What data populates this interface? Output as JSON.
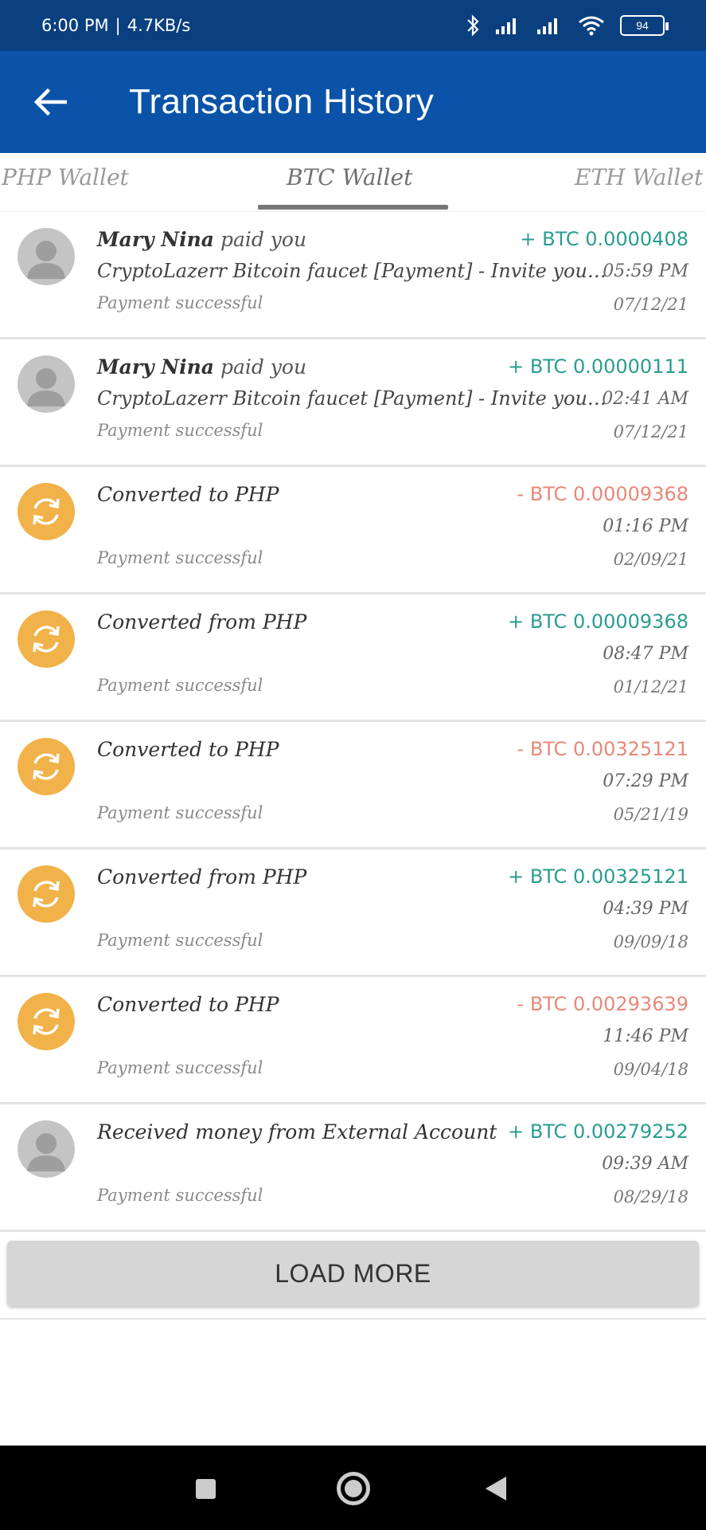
{
  "status_bar": {
    "time": "6:00 PM",
    "separator": "|",
    "net_speed": "4.7KB/s",
    "battery": "94"
  },
  "app_bar": {
    "title": "Transaction History",
    "back_icon": "arrow-left-icon"
  },
  "tabs": [
    {
      "label": "PHP Wallet",
      "active": false
    },
    {
      "label": "BTC Wallet",
      "active": true
    },
    {
      "label": "ETH Wallet",
      "active": false
    }
  ],
  "transactions": [
    {
      "avatar": "person",
      "name": "Mary Nina",
      "verb": "paid you",
      "title": "",
      "amount": "+ BTC 0.0000408",
      "sign": "pos",
      "description": "CryptoLazerr Bitcoin faucet [Payment] - Invite your friends",
      "time": "05:59 PM",
      "status": "Payment successful",
      "date": "07/12/21"
    },
    {
      "avatar": "person",
      "name": "Mary Nina",
      "verb": "paid you",
      "title": "",
      "amount": "+ BTC 0.00000111",
      "sign": "pos",
      "description": "CryptoLazerr Bitcoin faucet [Payment] - Invite your friends",
      "time": "02:41 AM",
      "status": "Payment successful",
      "date": "07/12/21"
    },
    {
      "avatar": "convert",
      "name": "",
      "verb": "",
      "title": "Converted to PHP",
      "amount": "- BTC 0.00009368",
      "sign": "neg",
      "description": "",
      "time": "01:16 PM",
      "status": "Payment successful",
      "date": "02/09/21"
    },
    {
      "avatar": "convert",
      "name": "",
      "verb": "",
      "title": "Converted from PHP",
      "amount": "+ BTC 0.00009368",
      "sign": "pos",
      "description": "",
      "time": "08:47 PM",
      "status": "Payment successful",
      "date": "01/12/21"
    },
    {
      "avatar": "convert",
      "name": "",
      "verb": "",
      "title": "Converted to PHP",
      "amount": "- BTC 0.00325121",
      "sign": "neg",
      "description": "",
      "time": "07:29 PM",
      "status": "Payment successful",
      "date": "05/21/19"
    },
    {
      "avatar": "convert",
      "name": "",
      "verb": "",
      "title": "Converted from PHP",
      "amount": "+ BTC 0.00325121",
      "sign": "pos",
      "description": "",
      "time": "04:39 PM",
      "status": "Payment successful",
      "date": "09/09/18"
    },
    {
      "avatar": "convert",
      "name": "",
      "verb": "",
      "title": "Converted to PHP",
      "amount": "- BTC 0.00293639",
      "sign": "neg",
      "description": "",
      "time": "11:46 PM",
      "status": "Payment successful",
      "date": "09/04/18"
    },
    {
      "avatar": "person",
      "name": "",
      "verb": "",
      "title": "Received money from External Account",
      "amount": "+ BTC 0.00279252",
      "sign": "pos",
      "description": "",
      "time": "09:39 AM",
      "status": "Payment successful",
      "date": "08/29/18"
    }
  ],
  "load_more": {
    "label": "LOAD MORE"
  },
  "colors": {
    "status_bar": "#0a4080",
    "app_bar": "#0a53a8",
    "positive": "#2a9d8f",
    "negative": "#e88878",
    "convert_avatar": "#f1b24a",
    "person_avatar": "#c4c4c4"
  }
}
